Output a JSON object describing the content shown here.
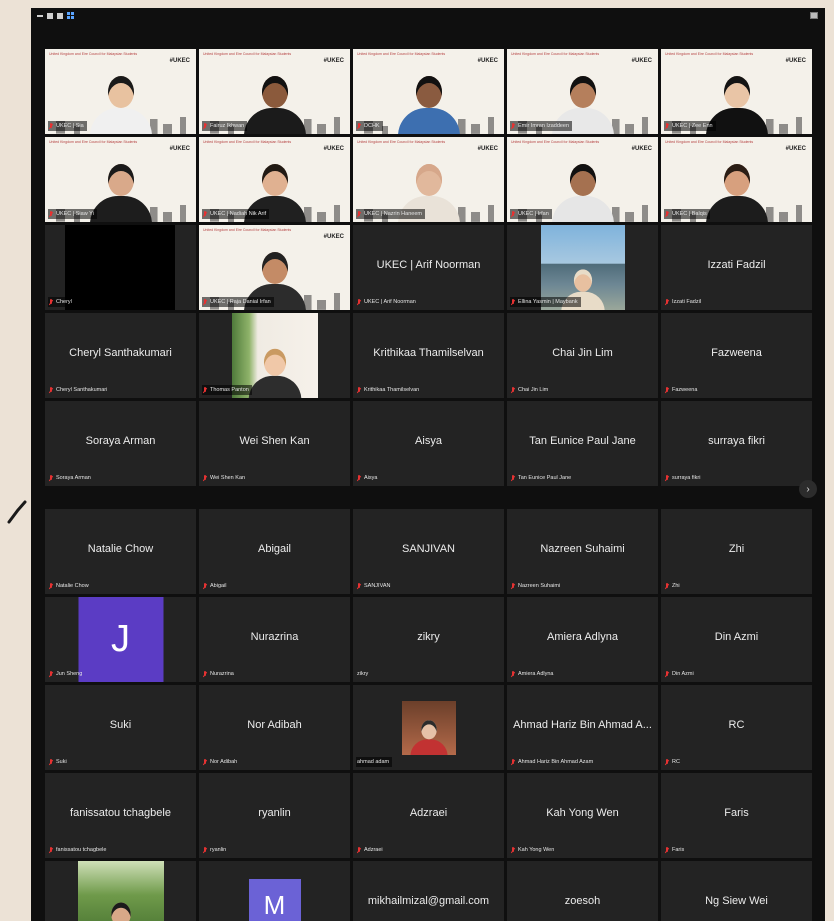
{
  "window": {
    "page1": [
      {
        "label": "UKEC | Sia",
        "type": "banner",
        "skin": "#e8c2a0",
        "hair": "#1a1a1a",
        "shirt": "#f0f0f0"
      },
      {
        "label": "Fairuz Ikhwan",
        "type": "banner",
        "skin": "#8b5a3c",
        "hair": "#111",
        "shirt": "#1b1b1b"
      },
      {
        "label": "DCHK",
        "type": "banner",
        "skin": "#8a5b40",
        "hair": "#111",
        "shirt": "#3d6fb0"
      },
      {
        "label": "Emir Imran Izaddeen",
        "type": "banner",
        "skin": "#b57f5c",
        "hair": "#111",
        "shirt": "#e8e8e8",
        "active": true
      },
      {
        "label": "UKEC | Zee Enn",
        "type": "banner",
        "skin": "#e9c5a6",
        "hair": "#141414",
        "shirt": "#111"
      },
      {
        "label": "UKEC | Siaw Yi",
        "type": "banner",
        "skin": "#d9a98a",
        "hair": "#1a1a1a",
        "shirt": "#1d1d1d"
      },
      {
        "label": "UKEC | Nadiah Nik Arif",
        "type": "banner",
        "skin": "#e0b191",
        "hair": "#211a14",
        "shirt": "#202020"
      },
      {
        "label": "UKEC | Nazrin Haneem",
        "type": "banner",
        "skin": "#e1b89c",
        "hair": "#d6a78a",
        "shirt": "#e9e2d8"
      },
      {
        "label": "UKEC | Irfan",
        "type": "banner",
        "skin": "#a57150",
        "hair": "#111",
        "shirt": "#e6e6e6"
      },
      {
        "label": "UKEC | Balqis",
        "type": "banner",
        "skin": "#d7a07e",
        "hair": "#2a1d15",
        "shirt": "#1c1c1c"
      },
      {
        "label": "Cheryl",
        "type": "black"
      },
      {
        "label": "UKEC | Raja Danial Irfan",
        "type": "banner",
        "skin": "#c48b66",
        "hair": "#222",
        "shirt": "#2c2c2c"
      },
      {
        "label": "UKEC | Arif Noorman",
        "type": "name",
        "name": "UKEC | Arif Noorman"
      },
      {
        "label": "Ellina Yasmin | Maybank",
        "type": "photo-city"
      },
      {
        "label": "Izzati Fadzil",
        "type": "name",
        "name": "Izzati Fadzil"
      },
      {
        "label": "Cheryl Santhakumari",
        "type": "name",
        "name": "Cheryl Santhakumari"
      },
      {
        "label": "Thomas Panton",
        "type": "photo-thomas"
      },
      {
        "label": "Krithikaa Thamilselvan",
        "type": "name",
        "name": "Krithikaa Thamilselvan"
      },
      {
        "label": "Chai Jin Lim",
        "type": "name",
        "name": "Chai Jin Lim"
      },
      {
        "label": "Fazweena",
        "type": "name",
        "name": "Fazweena"
      },
      {
        "label": "Soraya Arman",
        "type": "name",
        "name": "Soraya Arman"
      },
      {
        "label": "Wei Shen Kan",
        "type": "name",
        "name": "Wei Shen Kan"
      },
      {
        "label": "Aisya",
        "type": "name",
        "name": "Aisya"
      },
      {
        "label": "Tan Eunice Paul Jane",
        "type": "name",
        "name": "Tan Eunice Paul Jane"
      },
      {
        "label": "surraya fikri",
        "type": "name",
        "name": "surraya fikri"
      }
    ],
    "page2": [
      {
        "label": "Natalie Chow",
        "type": "name",
        "name": "Natalie Chow"
      },
      {
        "label": "Abigail",
        "type": "name",
        "name": "Abigail"
      },
      {
        "label": "SANJIVAN",
        "type": "name",
        "name": "SANJIVAN"
      },
      {
        "label": "Nazreen Suhaimi",
        "type": "name",
        "name": "Nazreen Suhaimi"
      },
      {
        "label": "Zhi",
        "type": "name",
        "name": "Zhi"
      },
      {
        "label": "Jun Sheng",
        "type": "avatar",
        "letter": "J"
      },
      {
        "label": "Nurazrina",
        "type": "name",
        "name": "Nurazrina"
      },
      {
        "label": "zikry",
        "type": "name",
        "name": "zikry",
        "unmuted": true
      },
      {
        "label": "Amiera Adlyna",
        "type": "name",
        "name": "Amiera Adlyna"
      },
      {
        "label": "Din Azmi",
        "type": "name",
        "name": "Din Azmi"
      },
      {
        "label": "Suki",
        "type": "name",
        "name": "Suki"
      },
      {
        "label": "Nor Adibah",
        "type": "name",
        "name": "Nor Adibah"
      },
      {
        "label": "ahmad adam",
        "type": "photo-mask",
        "unmuted": true
      },
      {
        "label": "Ahmad Hariz Bin Ahmad Azam",
        "type": "name",
        "name": "Ahmad Hariz Bin Ahmad A..."
      },
      {
        "label": "RC",
        "type": "name",
        "name": "RC"
      },
      {
        "label": "fanissatou tchagbele",
        "type": "name",
        "name": "fanissatou tchagbele"
      },
      {
        "label": "ryanlin",
        "type": "name",
        "name": "ryanlin"
      },
      {
        "label": "Adzraei",
        "type": "name",
        "name": "Adzraei"
      },
      {
        "label": "Kah Yong Wen",
        "type": "name",
        "name": "Kah Yong Wen"
      },
      {
        "label": "Faris",
        "type": "name",
        "name": "Faris"
      },
      {
        "label": "",
        "type": "photo-garden"
      },
      {
        "label": "",
        "type": "avatar-m",
        "letter": "M"
      },
      {
        "label": "",
        "type": "name",
        "name": "mikhailmizal@gmail.com"
      },
      {
        "label": "",
        "type": "name",
        "name": "zoesoh"
      },
      {
        "label": "",
        "type": "name",
        "name": "Ng Siew Wei"
      }
    ],
    "banner_text": "United Kingdom and Eire Council for Malaysian Students",
    "banner_logo": "#UKEC",
    "next_icon": "chevron-right-icon",
    "colors": {
      "active_border": "#c9e88b",
      "muted_mic": "#e63232",
      "tile_bg": "#232323"
    }
  }
}
